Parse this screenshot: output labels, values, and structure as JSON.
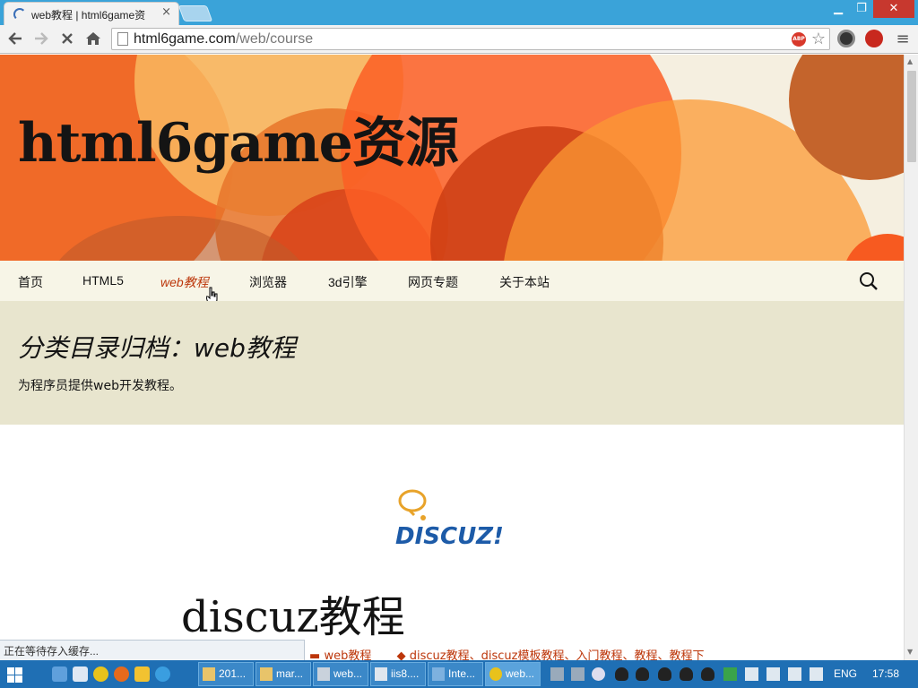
{
  "browser": {
    "tab_title": "web教程 | html6game资",
    "tab_close": "×",
    "url_host": "html6game.com",
    "url_path": "/web/course",
    "abp_label": "ABP"
  },
  "page": {
    "site_title": "html6game资源",
    "nav": [
      {
        "label": "首页"
      },
      {
        "label": "HTML5"
      },
      {
        "label": "web教程"
      },
      {
        "label": "浏览器"
      },
      {
        "label": "3d引擎"
      },
      {
        "label": "网页专题"
      },
      {
        "label": "关于本站"
      }
    ],
    "active_nav": "web教程",
    "archive_title": "分类目录归档：web教程",
    "archive_desc": "为程序员提供web开发教程。",
    "post_logo_text": "DISCUZ!",
    "post_title": "discuz教程",
    "post_category": "web教程",
    "post_tags": "discuz教程、discuz模板教程、入门教程、教程、教程下"
  },
  "status_bar": "正在等待存入缓存...",
  "taskbar": {
    "buttons": [
      {
        "label": "201..."
      },
      {
        "label": "mar..."
      },
      {
        "label": "web..."
      },
      {
        "label": "iis8...."
      },
      {
        "label": "Inte..."
      },
      {
        "label": "web..."
      }
    ],
    "language": "ENG",
    "clock": "17:58"
  },
  "colors": {
    "accent": "#bc360a",
    "titlebar": "#3aa3d9",
    "taskbar": "#1f6fb4",
    "nav_bg": "#f7f5e7",
    "archive_bg": "#e8e5ce"
  },
  "icons": [
    "back-icon",
    "forward-icon",
    "stop-icon",
    "home-icon",
    "star-icon",
    "search-icon",
    "menu-icon"
  ]
}
